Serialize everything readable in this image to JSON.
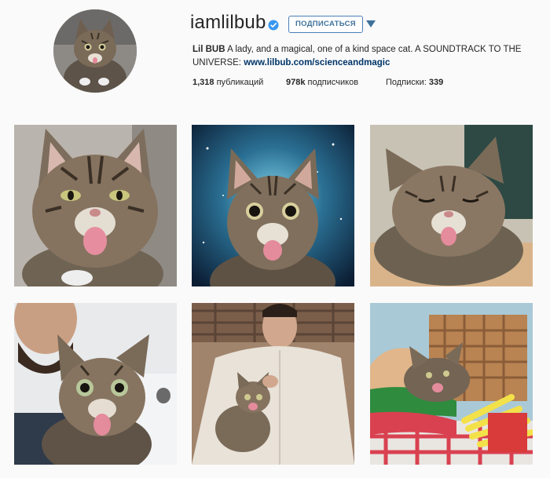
{
  "profile": {
    "username": "iamlilbub",
    "verified": true,
    "follow_label": "ПОДПИСАТЬСЯ",
    "bio_name": "Lil BUB",
    "bio_text": " A lady, and a magical, one of a kind space cat. A SOUNDTRACK TO THE UNIVERSE: ",
    "bio_link": "www.lilbub.com/scienceandmagic",
    "stats": {
      "posts_count": "1,318",
      "posts_label": " публикаций",
      "followers_count": "978k",
      "followers_label": " подписчиков",
      "following_label": "Подписки: ",
      "following_count": "339"
    }
  },
  "icons": {
    "verified": "verified-badge-icon",
    "dropdown": "triangle-down-icon"
  },
  "colors": {
    "accent": "#3f729b",
    "verified": "#3897f0",
    "link": "#003569",
    "background": "#fafafa"
  },
  "posts": [
    {
      "id": 1,
      "scene": "cat-closeup-tongue"
    },
    {
      "id": 2,
      "scene": "cat-space-background"
    },
    {
      "id": 3,
      "scene": "cat-eyes-closed-sunlight"
    },
    {
      "id": 4,
      "scene": "man-holding-cat"
    },
    {
      "id": 5,
      "scene": "man-lying-with-cat"
    },
    {
      "id": 6,
      "scene": "cat-picnic-basket"
    }
  ]
}
